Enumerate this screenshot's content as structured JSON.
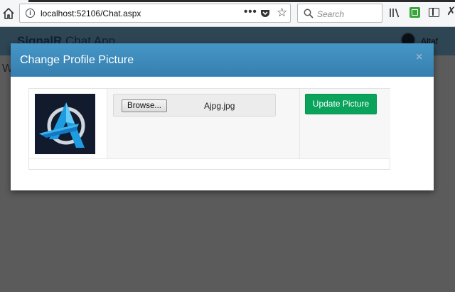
{
  "browser": {
    "url": "localhost:52106/Chat.aspx",
    "search_placeholder": "Search",
    "more_label": "•••"
  },
  "page": {
    "brand_bold": "SignalR",
    "brand_rest": "Chat App",
    "user_name": "Altaf",
    "partial_text": "W"
  },
  "modal": {
    "title": "Change Profile Picture",
    "close_label": "×",
    "browse_label": "Browse...",
    "file_name": "Ajpg.jpg",
    "update_label": "Update Picture"
  },
  "colors": {
    "modal_header": "#4596c6",
    "update_button": "#0aa35c",
    "overlay": "#5b5b5b"
  },
  "icons": [
    "home-icon",
    "info-icon",
    "pocket-icon",
    "bookmark-star-icon",
    "search-icon",
    "library-icon",
    "extension-icon",
    "sidebar-icon",
    "tools-icon",
    "close-icon",
    "profile-logo"
  ]
}
